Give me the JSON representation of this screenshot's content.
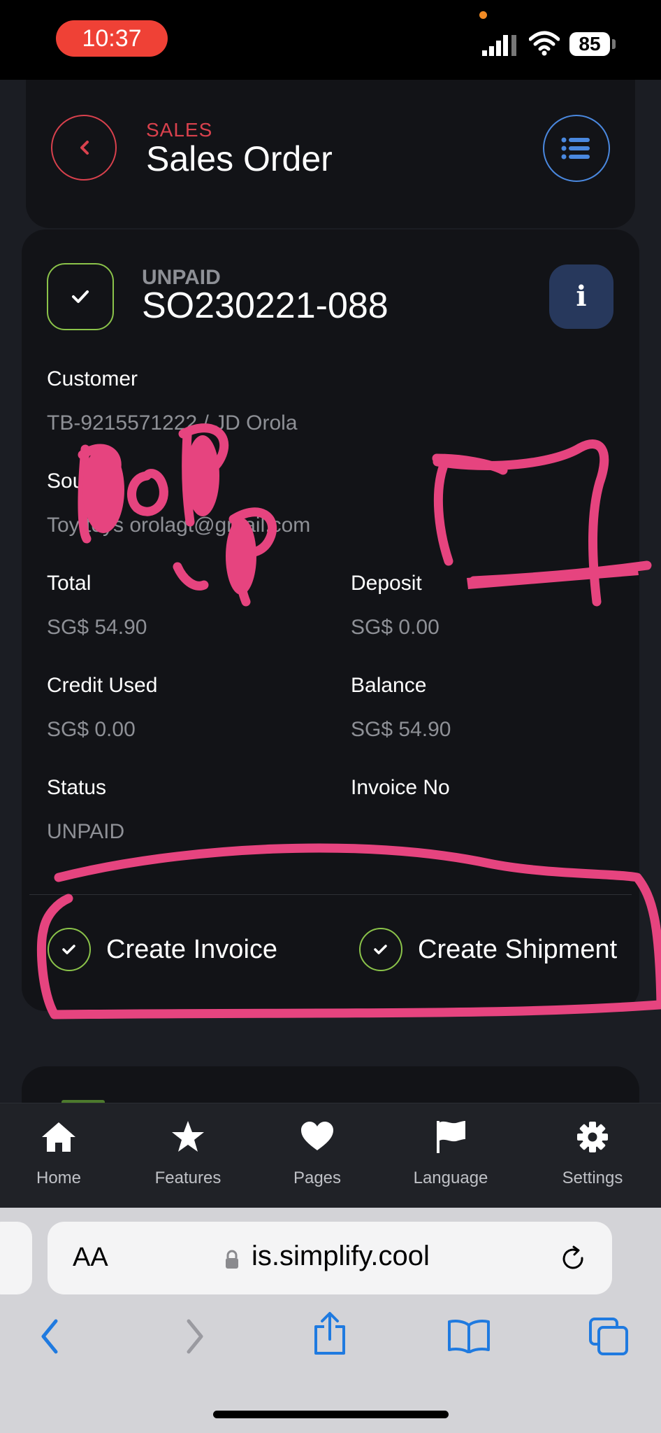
{
  "status_bar": {
    "time": "10:37",
    "battery": "85"
  },
  "header": {
    "eyebrow": "SALES",
    "title": "Sales Order"
  },
  "order": {
    "status_label": "UNPAID",
    "number": "SO230221-088",
    "customer_label": "Customer",
    "customer_value": "TB-9215571222 / JD Orola",
    "source_label": "Source",
    "source_value": "Toy toys orolagt@gmail.com",
    "total_label": "Total",
    "total_value": "SG$ 54.90",
    "deposit_label": "Deposit",
    "deposit_value": "SG$ 0.00",
    "credit_label": "Credit Used",
    "credit_value": "SG$ 0.00",
    "balance_label": "Balance",
    "balance_value": "SG$ 54.90",
    "status_field_label": "Status",
    "status_field_value": "UNPAID",
    "invoice_label": "Invoice No",
    "invoice_value": ""
  },
  "actions": {
    "create_invoice": "Create Invoice",
    "create_shipment": "Create Shipment"
  },
  "annotation": {
    "handwritten_text": "POP UP"
  },
  "bottom_nav": [
    {
      "label": "Home",
      "icon": "home-icon"
    },
    {
      "label": "Features",
      "icon": "star-icon"
    },
    {
      "label": "Pages",
      "icon": "heart-icon"
    },
    {
      "label": "Language",
      "icon": "flag-icon"
    },
    {
      "label": "Settings",
      "icon": "gear-icon"
    }
  ],
  "browser": {
    "aa_label": "AA",
    "url": "is.simplify.cool"
  },
  "colors": {
    "accent_red": "#d9414d",
    "accent_blue": "#4a88df",
    "accent_green": "#8bc34a",
    "scribble_pink": "#e6447f",
    "ios_blue": "#1f7ae0"
  }
}
